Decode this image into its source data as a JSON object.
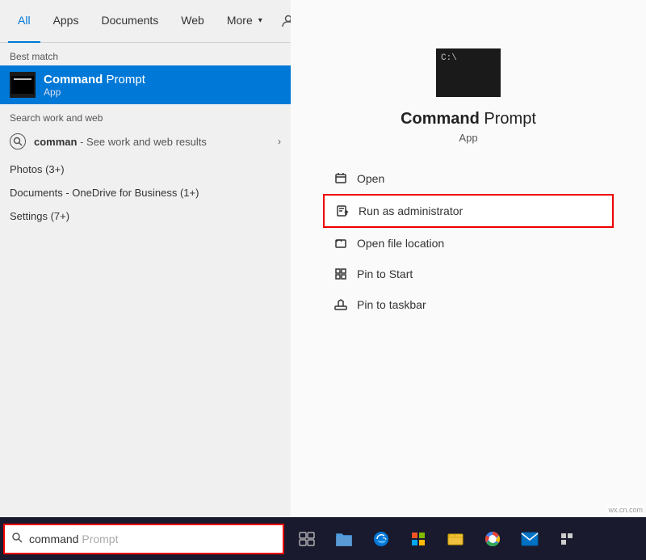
{
  "tabs": {
    "items": [
      {
        "id": "all",
        "label": "All",
        "active": true
      },
      {
        "id": "apps",
        "label": "Apps",
        "active": false
      },
      {
        "id": "documents",
        "label": "Documents",
        "active": false
      },
      {
        "id": "web",
        "label": "Web",
        "active": false
      },
      {
        "id": "more",
        "label": "More",
        "active": false
      }
    ]
  },
  "best_match": {
    "section_label": "Best match",
    "name_bold": "Command",
    "name_rest": " Prompt",
    "type": "App"
  },
  "search_web": {
    "section_label": "Search work and web",
    "item": {
      "bold": "comman",
      "rest": " - See work and web results"
    }
  },
  "other_results": [
    {
      "label": "Photos (3+)"
    },
    {
      "label": "Documents - OneDrive for Business (1+)"
    },
    {
      "label": "Settings (7+)"
    }
  ],
  "right_panel": {
    "app_name_bold": "Command",
    "app_name_rest": " Prompt",
    "app_type": "App",
    "actions": [
      {
        "id": "open",
        "label": "Open",
        "highlighted": false
      },
      {
        "id": "run-admin",
        "label": "Run as administrator",
        "highlighted": true
      },
      {
        "id": "open-file-loc",
        "label": "Open file location",
        "highlighted": false
      },
      {
        "id": "pin-start",
        "label": "Pin to Start",
        "highlighted": false
      },
      {
        "id": "pin-taskbar",
        "label": "Pin to taskbar",
        "highlighted": false
      }
    ]
  },
  "search_box": {
    "typed": "command",
    "placeholder": " Prompt"
  },
  "taskbar": {
    "start_label": "⊞",
    "search_icon": "🔍"
  },
  "watermark": "wx.cn.com"
}
